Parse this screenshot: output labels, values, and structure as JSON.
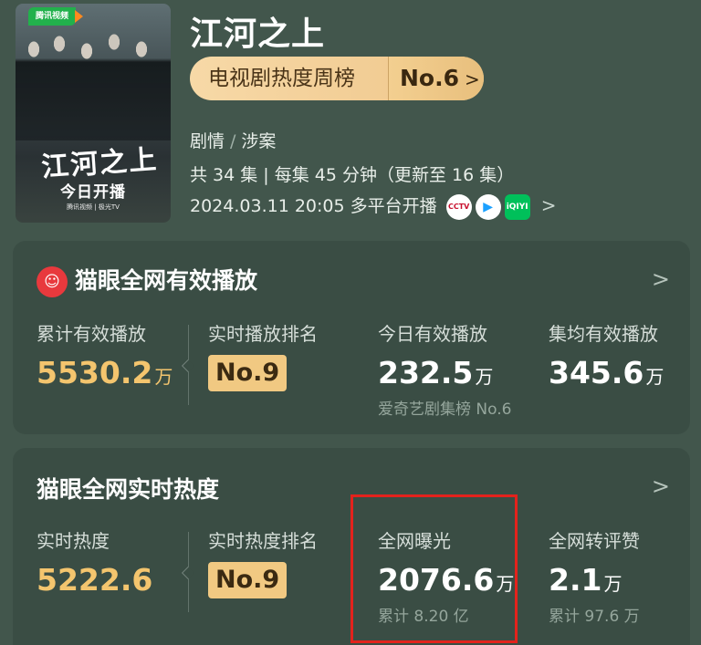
{
  "poster": {
    "badge": "腾讯视频",
    "title": "江河之上",
    "subtitle": "今日开播",
    "logos": "腾讯视频 | 极光TV"
  },
  "header": {
    "title": "江河之上",
    "rank_label": "电视剧热度周榜",
    "rank_value": "No.6",
    "rank_arrow": ">",
    "genre_1": "剧情",
    "genre_sep": "/",
    "genre_2": "涉案",
    "episodes": "共 34 集 | 每集 45 分钟（更新至 16 集）",
    "premiere": "2024.03.11 20:05 多平台开播",
    "platforms": [
      {
        "name": "cctv-logo",
        "text": "CCTV"
      },
      {
        "name": "tencent-video-logo",
        "text": "▶"
      },
      {
        "name": "iqiyi-logo",
        "text": "iQIYI"
      }
    ],
    "chevron": ">"
  },
  "card_playback": {
    "title": "猫眼全网有效播放",
    "icon_glyph": "☺",
    "chevron": ">",
    "cumulative_label": "累计有效播放",
    "cumulative_value": "5530.2",
    "cumulative_unit": "万",
    "realtime_rank_label": "实时播放排名",
    "realtime_rank_value": "No.9",
    "today_label": "今日有效播放",
    "today_value": "232.5",
    "today_unit": "万",
    "today_sub": "爱奇艺剧集榜 No.6",
    "avg_label": "集均有效播放",
    "avg_value": "345.6",
    "avg_unit": "万"
  },
  "card_heat": {
    "title": "猫眼全网实时热度",
    "chevron": ">",
    "heat_label": "实时热度",
    "heat_value": "5222.6",
    "heat_rank_label": "实时热度排名",
    "heat_rank_value": "No.9",
    "exposure_label": "全网曝光",
    "exposure_value": "2076.6",
    "exposure_unit": "万",
    "exposure_sub": "累计 8.20 亿",
    "engage_label": "全网转评赞",
    "engage_value": "2.1",
    "engage_unit": "万",
    "engage_sub": "累计 97.6 万"
  },
  "colors": {
    "background": "#42564c",
    "card": "#3a4d44",
    "gold": "#f4c56e",
    "highlight": "#e3221c"
  }
}
